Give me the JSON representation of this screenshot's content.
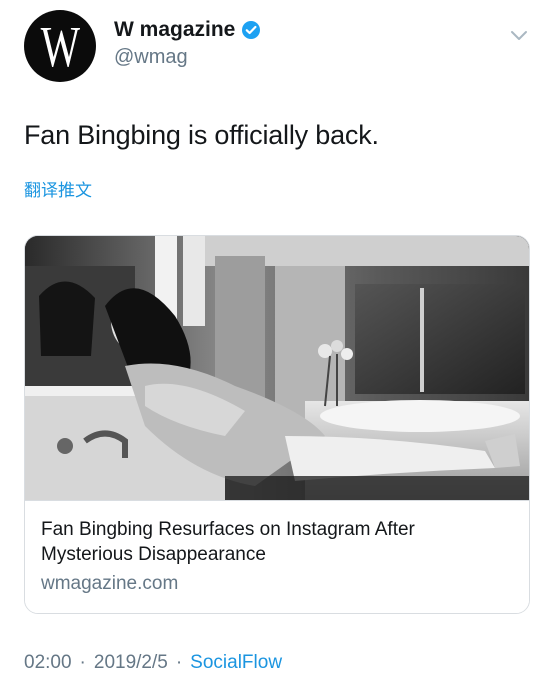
{
  "tweet": {
    "avatar_letter": "W",
    "display_name": "W magazine",
    "handle": "@wmag",
    "text": "Fan Bingbing is officially back.",
    "translate_label": "翻译推文",
    "verified_color": "#1da1f2",
    "link_color": "#1b95e0"
  },
  "card": {
    "title": "Fan Bingbing Resurfaces on Instagram After Mysterious Disappearance",
    "domain": "wmagazine.com",
    "image_description_icon": "photo"
  },
  "meta": {
    "time": "02:00",
    "separator": "·",
    "date": "2019/2/5",
    "source": "SocialFlow"
  },
  "icons": {
    "verified": "verified-badge-icon",
    "menu": "chevron-down-icon"
  }
}
